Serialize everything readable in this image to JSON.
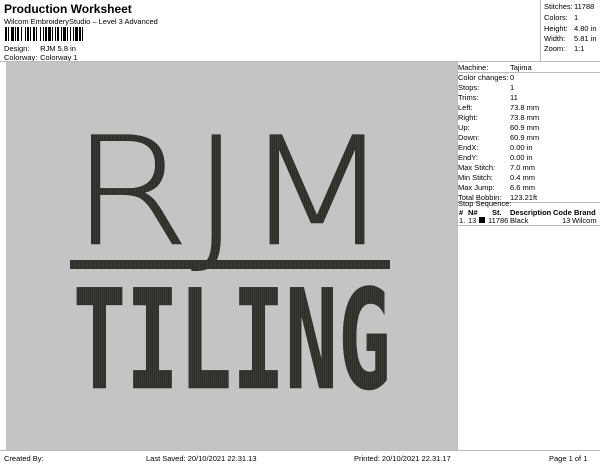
{
  "header": {
    "title": "Production Worksheet",
    "software": "Wilcom EmbroideryStudio – Level 3 Advanced",
    "design_label": "Design:",
    "design_value": "RJM 5.8 in",
    "colorway_label": "Colorway:",
    "colorway_value": "Colorway 1"
  },
  "stats": [
    {
      "label": "Stitches:",
      "value": "11788"
    },
    {
      "label": "Colors:",
      "value": "1"
    },
    {
      "label": "Height:",
      "value": "4.80 in"
    },
    {
      "label": "Width:",
      "value": "5.81 in"
    },
    {
      "label": "Zoom:",
      "value": "1:1"
    }
  ],
  "machine_info": [
    {
      "label": "Machine:",
      "value": "Tajima"
    },
    {
      "label": "Color changes:",
      "value": "0"
    },
    {
      "label": "Stops:",
      "value": "1"
    },
    {
      "label": "Trims:",
      "value": "11"
    },
    {
      "label": "Left:",
      "value": "73.8 mm"
    },
    {
      "label": "Right:",
      "value": "73.8 mm"
    },
    {
      "label": "Up:",
      "value": "60.9 mm"
    },
    {
      "label": "Down:",
      "value": "60.9 mm"
    },
    {
      "label": "EndX:",
      "value": "0.00 in"
    },
    {
      "label": "EndY:",
      "value": "0.00 in"
    },
    {
      "label": "Max Stitch:",
      "value": "7.0 mm"
    },
    {
      "label": "Min Stitch:",
      "value": "0.4 mm"
    },
    {
      "label": "Max Jump:",
      "value": "6.6 mm"
    },
    {
      "label": "Total Bobbin:",
      "value": "123.21ft"
    }
  ],
  "stop_sequence": {
    "title": "Stop Sequence:",
    "headers": {
      "num": "#",
      "n": "N#",
      "st": "St.",
      "description": "Description",
      "code": "Code",
      "brand": "Brand"
    },
    "rows": [
      {
        "num": "1.",
        "n": "13",
        "color": "#000000",
        "st": "11786",
        "description": "Black",
        "code": "13",
        "brand": "Wilcom"
      }
    ]
  },
  "design_art": {
    "line1": "RJM",
    "line2": "TILING",
    "thread_color": "#3a3a34",
    "background": "#c4c4c4"
  },
  "footer": {
    "created_by": "Created By:",
    "last_saved": "Last Saved: 20/10/2021 22.31.13",
    "printed": "Printed: 20/10/2021 22.31.17",
    "page": "Page 1 of 1"
  }
}
